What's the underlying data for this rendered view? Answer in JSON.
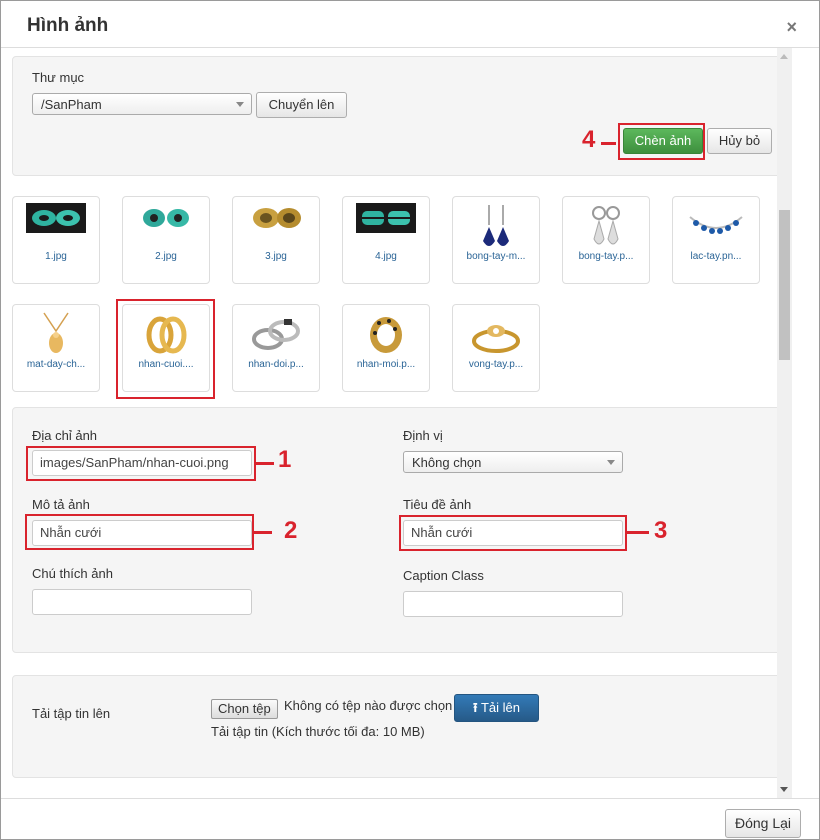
{
  "dialog": {
    "title": "Hình ảnh",
    "close": "×"
  },
  "folder": {
    "label": "Thư mục",
    "selected": "/SanPham",
    "up_button": "Chuyển lên"
  },
  "actions": {
    "insert": "Chèn ảnh",
    "cancel": "Hủy bỏ"
  },
  "thumbnails": [
    {
      "caption": "1.jpg"
    },
    {
      "caption": "2.jpg"
    },
    {
      "caption": "3.jpg"
    },
    {
      "caption": "4.jpg"
    },
    {
      "caption": "bong-tay-m..."
    },
    {
      "caption": "bong-tay.p..."
    },
    {
      "caption": "lac-tay.pn..."
    },
    {
      "caption": "mat-day-ch..."
    },
    {
      "caption": "nhan-cuoi...."
    },
    {
      "caption": "nhan-doi.p..."
    },
    {
      "caption": "nhan-moi.p..."
    },
    {
      "caption": "vong-tay.p..."
    }
  ],
  "form": {
    "url_label": "Địa chỉ ảnh",
    "url_value": "images/SanPham/nhan-cuoi.png",
    "align_label": "Định vị",
    "align_value": "Không chọn",
    "alt_label": "Mô tả ảnh",
    "alt_value": "Nhẫn cưới",
    "title_label": "Tiêu đề ảnh",
    "title_value": "Nhẫn cưới",
    "caption_label": "Chú thích ảnh",
    "caption_value": "",
    "caption_class_label": "Caption Class",
    "caption_class_value": ""
  },
  "upload": {
    "label": "Tải tập tin lên",
    "choose_button": "Chọn tệp",
    "no_file": "Không có tệp nào được chọn",
    "upload_button": "Tải lên",
    "hint": "Tải tập tin (Kích thước tối đa: 10 MB)"
  },
  "annotations": {
    "n1": "1",
    "n2": "2",
    "n3": "3",
    "n4": "4"
  },
  "footer": {
    "close_button": "Đóng Lại"
  },
  "colors": {
    "annotation": "#d9232d",
    "insert_button": "#449d44",
    "upload_button": "#2e6da4",
    "link": "#2a6496"
  }
}
